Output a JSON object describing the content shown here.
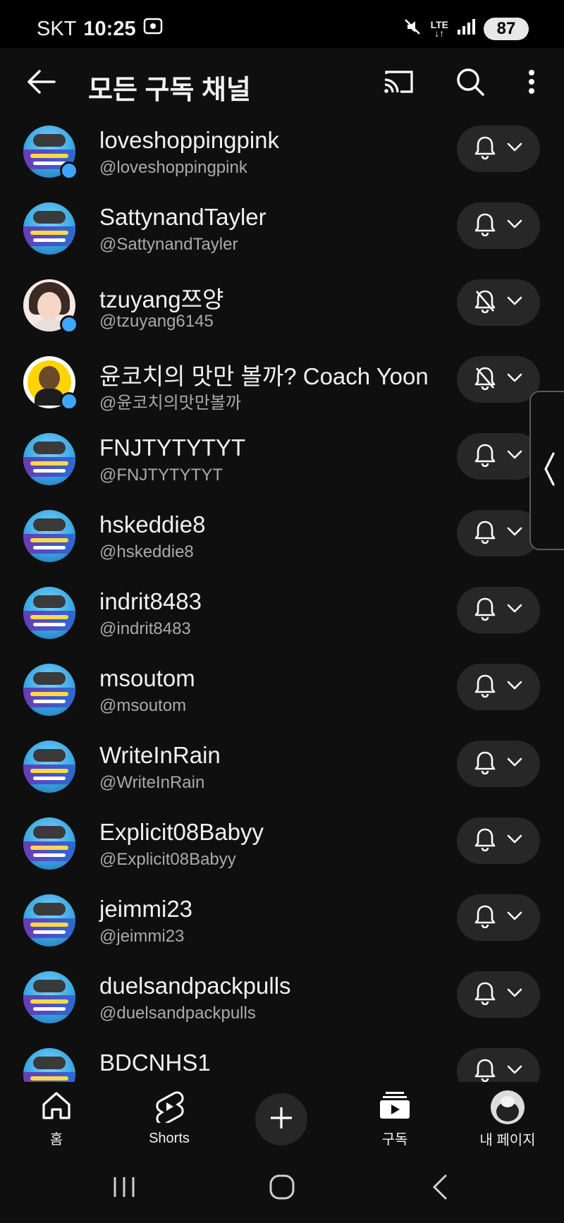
{
  "status_bar": {
    "carrier": "SKT",
    "time": "10:25",
    "network": "LTE",
    "battery": "87"
  },
  "header": {
    "title": "모든 구독 채널",
    "icons": [
      "back-arrow-icon",
      "cast-icon",
      "search-icon",
      "more-vert-icon"
    ]
  },
  "channels": [
    {
      "name": "loveshoppingpink",
      "handle": "@loveshoppingpink",
      "avatar": "thumbnail",
      "new_dot": true,
      "notify": "on"
    },
    {
      "name": "SattynandTayler",
      "handle": "@SattynandTayler",
      "avatar": "thumbnail",
      "new_dot": false,
      "notify": "on"
    },
    {
      "name": "tzuyang쯔양",
      "handle": "@tzuyang6145",
      "avatar": "face",
      "new_dot": true,
      "notify": "off"
    },
    {
      "name": "윤코치의 맛만 볼까? Coach Yoon",
      "handle": "@윤코치의맛만볼까",
      "avatar": "coach",
      "new_dot": true,
      "notify": "off"
    },
    {
      "name": "FNJTYTYTYT",
      "handle": "@FNJTYTYTYT",
      "avatar": "thumbnail",
      "new_dot": false,
      "notify": "on"
    },
    {
      "name": "hskeddie8",
      "handle": "@hskeddie8",
      "avatar": "thumbnail",
      "new_dot": false,
      "notify": "on"
    },
    {
      "name": "indrit8483",
      "handle": "@indrit8483",
      "avatar": "thumbnail",
      "new_dot": false,
      "notify": "on"
    },
    {
      "name": "msoutom",
      "handle": "@msoutom",
      "avatar": "thumbnail",
      "new_dot": false,
      "notify": "on"
    },
    {
      "name": "WriteInRain",
      "handle": "@WriteInRain",
      "avatar": "thumbnail",
      "new_dot": false,
      "notify": "on"
    },
    {
      "name": "Explicit08Babyy",
      "handle": "@Explicit08Babyy",
      "avatar": "thumbnail",
      "new_dot": false,
      "notify": "on"
    },
    {
      "name": "jeimmi23",
      "handle": "@jeimmi23",
      "avatar": "thumbnail",
      "new_dot": false,
      "notify": "on"
    },
    {
      "name": "duelsandpackpulls",
      "handle": "@duelsandpackpulls",
      "avatar": "thumbnail",
      "new_dot": false,
      "notify": "on"
    },
    {
      "name": "BDCNHS1",
      "handle": "",
      "avatar": "thumbnail",
      "new_dot": false,
      "notify": "on"
    }
  ],
  "bottom_nav": {
    "home": "홈",
    "shorts": "Shorts",
    "subscriptions": "구독",
    "me": "내 페이지"
  },
  "colors": {
    "background": "#0f0f0f",
    "pill": "#272727",
    "new_dot": "#3ea6ff",
    "handle_text": "#aaaaaa"
  }
}
